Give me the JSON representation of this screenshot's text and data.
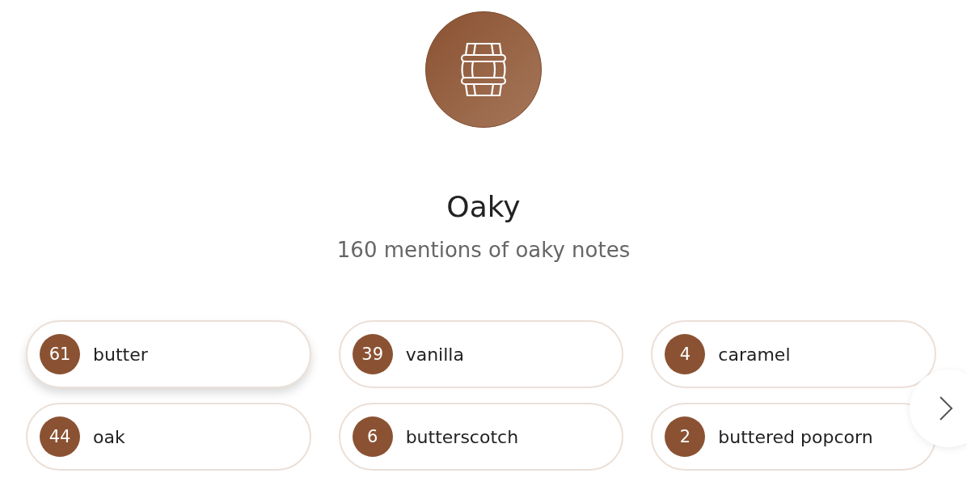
{
  "category": {
    "title": "Oaky",
    "subtitle": "160 mentions of oaky notes"
  },
  "notes": [
    {
      "count": "61",
      "label": "butter",
      "selected": true
    },
    {
      "count": "39",
      "label": "vanilla",
      "selected": false
    },
    {
      "count": "4",
      "label": "caramel",
      "selected": false
    },
    {
      "count": "44",
      "label": "oak",
      "selected": false
    },
    {
      "count": "6",
      "label": "butterscotch",
      "selected": false
    },
    {
      "count": "2",
      "label": "buttered popcorn",
      "selected": false
    }
  ]
}
